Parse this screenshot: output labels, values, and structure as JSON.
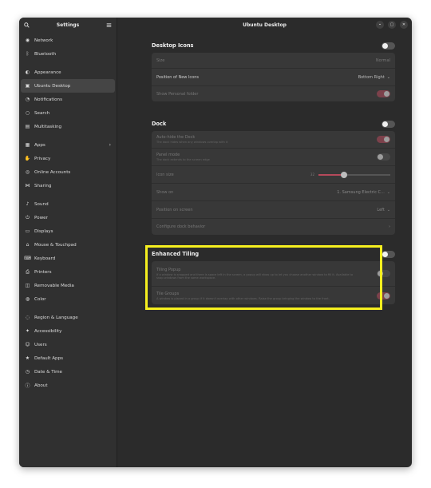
{
  "sidebar": {
    "title": "Settings",
    "items": [
      {
        "label": "Network",
        "icon": "network-icon"
      },
      {
        "label": "Bluetooth",
        "icon": "bluetooth-icon"
      },
      {
        "label": "Appearance",
        "icon": "appearance-icon"
      },
      {
        "label": "Ubuntu Desktop",
        "icon": "ubuntu-desktop-icon",
        "selected": true
      },
      {
        "label": "Notifications",
        "icon": "bell-icon"
      },
      {
        "label": "Search",
        "icon": "search-icon"
      },
      {
        "label": "Multitasking",
        "icon": "multitasking-icon"
      },
      {
        "label": "Apps",
        "icon": "apps-icon",
        "chevron": true
      },
      {
        "label": "Privacy",
        "icon": "hand-icon"
      },
      {
        "label": "Online Accounts",
        "icon": "accounts-icon"
      },
      {
        "label": "Sharing",
        "icon": "share-icon"
      },
      {
        "label": "Sound",
        "icon": "music-note-icon"
      },
      {
        "label": "Power",
        "icon": "power-icon"
      },
      {
        "label": "Displays",
        "icon": "display-icon"
      },
      {
        "label": "Mouse & Touchpad",
        "icon": "mouse-icon"
      },
      {
        "label": "Keyboard",
        "icon": "keyboard-icon"
      },
      {
        "label": "Printers",
        "icon": "printer-icon"
      },
      {
        "label": "Removable Media",
        "icon": "media-icon"
      },
      {
        "label": "Color",
        "icon": "color-icon"
      },
      {
        "label": "Region & Language",
        "icon": "globe-icon"
      },
      {
        "label": "Accessibility",
        "icon": "accessibility-icon"
      },
      {
        "label": "Users",
        "icon": "users-icon"
      },
      {
        "label": "Default Apps",
        "icon": "star-icon"
      },
      {
        "label": "Date & Time",
        "icon": "clock-icon"
      },
      {
        "label": "About",
        "icon": "info-icon"
      }
    ]
  },
  "header": {
    "title": "Ubuntu Desktop"
  },
  "desktop_icons": {
    "title": "Desktop Icons",
    "size_label": "Size",
    "size_value": "Normal",
    "position_label": "Position of New Icons",
    "position_value": "Bottom Right",
    "personal_folder_label": "Show Personal folder"
  },
  "dock": {
    "title": "Dock",
    "autohide_label": "Auto-hide the Dock",
    "autohide_sub": "The dock hides when any windows overlap with it",
    "panel_label": "Panel mode",
    "panel_sub": "The dock extends to the screen edge",
    "icon_size_label": "Icon size",
    "icon_size_value": "32",
    "icon_size_fraction": 0.35,
    "show_on_label": "Show on",
    "show_on_value": "1. Samsung Electric C...",
    "position_label": "Position on screen",
    "position_value": "Left",
    "configure_label": "Configure dock behavior"
  },
  "tiling": {
    "title": "Enhanced Tiling",
    "popup_label": "Tiling Popup",
    "popup_sub": "If a window is snapped and there is space left in the screen, a popup will show up to let you choose another window to fill it. Available to snap windows from the same workspace.",
    "groups_label": "Tile Groups",
    "groups_sub": "A window is placed in a group if it doesn't overlap with other windows. Raise the group bringing the window to the front."
  },
  "colors": {
    "accent": "#b5495b",
    "highlight": "#f5ef1f"
  }
}
